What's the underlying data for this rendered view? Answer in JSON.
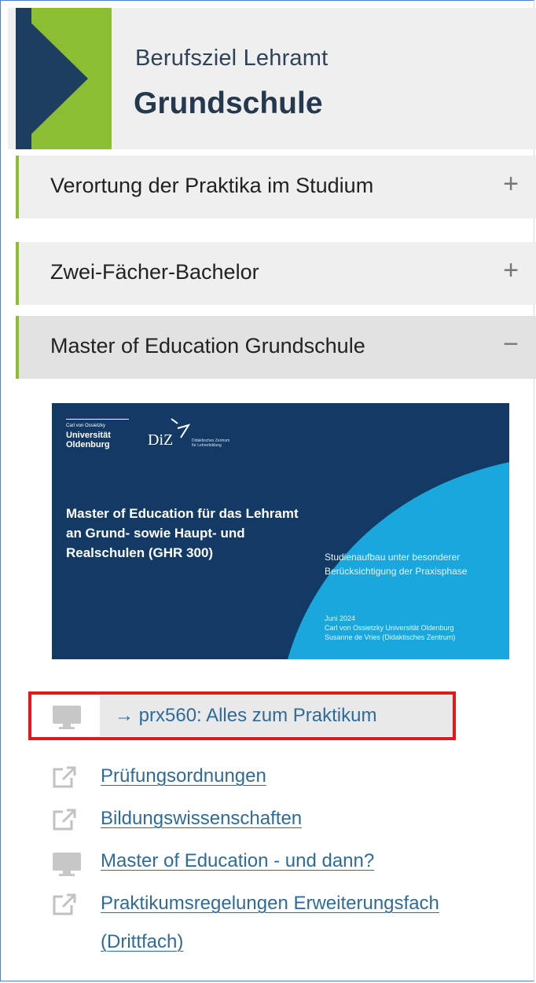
{
  "header": {
    "subtitle": "Berufsziel Lehramt",
    "title": "Grundschule"
  },
  "accordion": [
    {
      "label": "Verortung der Praktika im Studium",
      "sign": "+"
    },
    {
      "label": "Zwei-Fächer-Bachelor",
      "sign": "+"
    },
    {
      "label": "Master of Education Grundschule",
      "sign": "−"
    }
  ],
  "slide": {
    "logo_tiny": "Carl von Ossietzky",
    "logo_line1": "Universität",
    "logo_line2": "Oldenburg",
    "diz": "DiZ",
    "diz_tiny": "Didaktisches Zentrum für Lehrerbildung",
    "title": "Master of Education für das Lehramt an Grund- sowie Haupt- und Realschulen (GHR 300)",
    "right_text": "Studienaufbau unter besonderer Berücksichtigung der Praxisphase",
    "date": "Juni 2024",
    "org": "Carl von Ossietzky Universität Oldenburg",
    "author": "Susanne de Vries (Didaktisches Zentrum)"
  },
  "highlighted_link": {
    "text": "→ prx560: Alles zum Praktikum",
    "icon": "monitor-icon"
  },
  "links": [
    {
      "text": "Prüfungsordnungen",
      "icon": "external-link-icon"
    },
    {
      "text": "Bildungswissenschaften",
      "icon": "external-link-icon"
    },
    {
      "text": "Master of Education - und dann?",
      "icon": "monitor-icon"
    },
    {
      "text": "Praktikumsregelungen Erweiterungsfach",
      "text2": "(Drittfach)",
      "icon": "external-link-icon"
    }
  ],
  "colors": {
    "green": "#8cbe33",
    "navy": "#1d3e5e",
    "link": "#2f6b99",
    "highlight": "#e0191e"
  }
}
